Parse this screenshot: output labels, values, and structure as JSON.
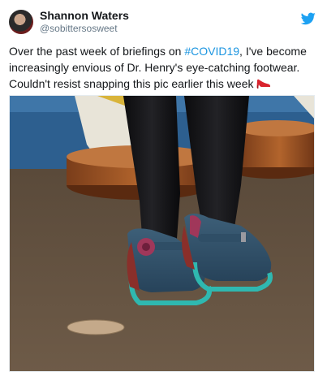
{
  "author": {
    "display_name": "Shannon Waters",
    "handle": "@sobittersosweet"
  },
  "tweet": {
    "text_before": "Over the past week of briefings on ",
    "hashtag": "#COVID19",
    "text_after": ", I've become increasingly envious of Dr. Henry's eye-catching footwear. Couldn't resist snapping this pic earlier this week "
  },
  "icons": {
    "logo": "twitter-bird-icon",
    "emoji": "high-heel-shoe-emoji"
  },
  "colors": {
    "accent": "#1da1f2",
    "hashtag": "#1b95e0",
    "handle": "#657786"
  }
}
